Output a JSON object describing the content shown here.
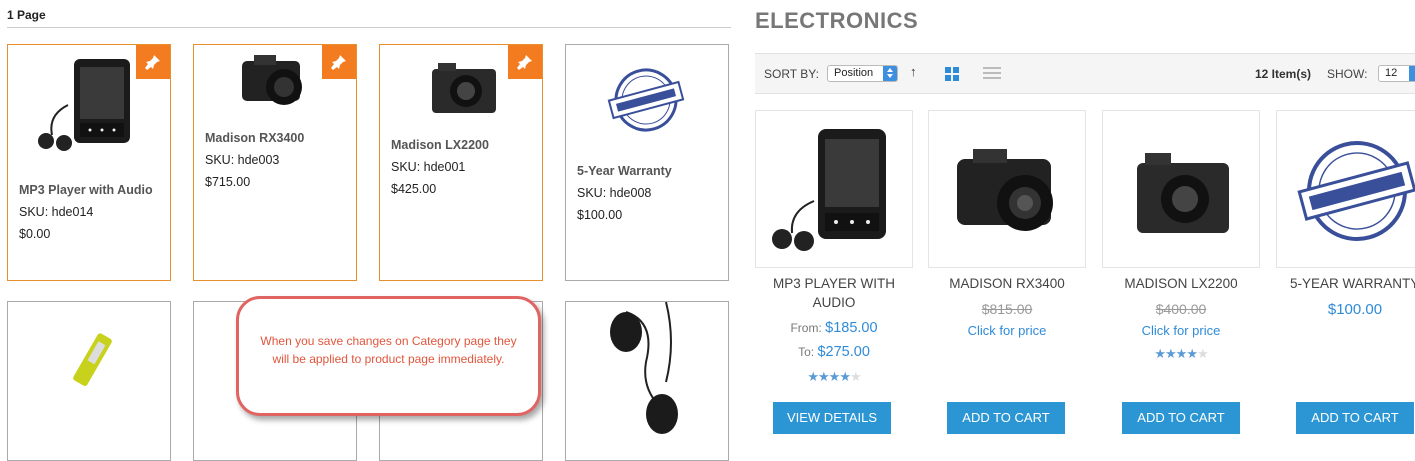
{
  "admin": {
    "page_label": "1 Page",
    "cards": [
      {
        "name": "MP3 Player with Audio",
        "sku": "SKU: hde014",
        "price": "$0.00",
        "pinned": true
      },
      {
        "name": "Madison RX3400",
        "sku": "SKU: hde003",
        "price": "$715.00",
        "pinned": true
      },
      {
        "name": "Madison LX2200",
        "sku": "SKU: hde001",
        "price": "$425.00",
        "pinned": true
      },
      {
        "name": "5-Year Warranty",
        "sku": "SKU: hde008",
        "price": "$100.00",
        "pinned": false
      }
    ],
    "callout": "When you save changes on Category page they will be applied to product page immediately."
  },
  "store": {
    "category_title": "ELECTRONICS",
    "toolbar": {
      "sort_label": "SORT BY:",
      "sort_value": "Position",
      "direction_icon": "up-arrow-icon",
      "item_count": "12 Item(s)",
      "show_label": "SHOW:",
      "limit_value": "12"
    },
    "products": [
      {
        "name": "MP3 PLAYER WITH AUDIO",
        "from_label": "From:",
        "from_price": "$185.00",
        "to_label": "To:",
        "to_price": "$275.00",
        "rating": 4,
        "button": "VIEW DETAILS"
      },
      {
        "name": "MADISON RX3400",
        "old_price": "$815.00",
        "price_link": "Click for price",
        "button": "ADD TO CART"
      },
      {
        "name": "MADISON LX2200",
        "old_price": "$400.00",
        "price_link": "Click for price",
        "rating": 4,
        "button": "ADD TO CART"
      },
      {
        "name": "5-YEAR WARRANTY",
        "price": "$100.00",
        "button": "ADD TO CART"
      }
    ]
  },
  "colors": {
    "accent": "#2b96d3",
    "pin": "#f37b20",
    "callout_border": "#e06562"
  }
}
